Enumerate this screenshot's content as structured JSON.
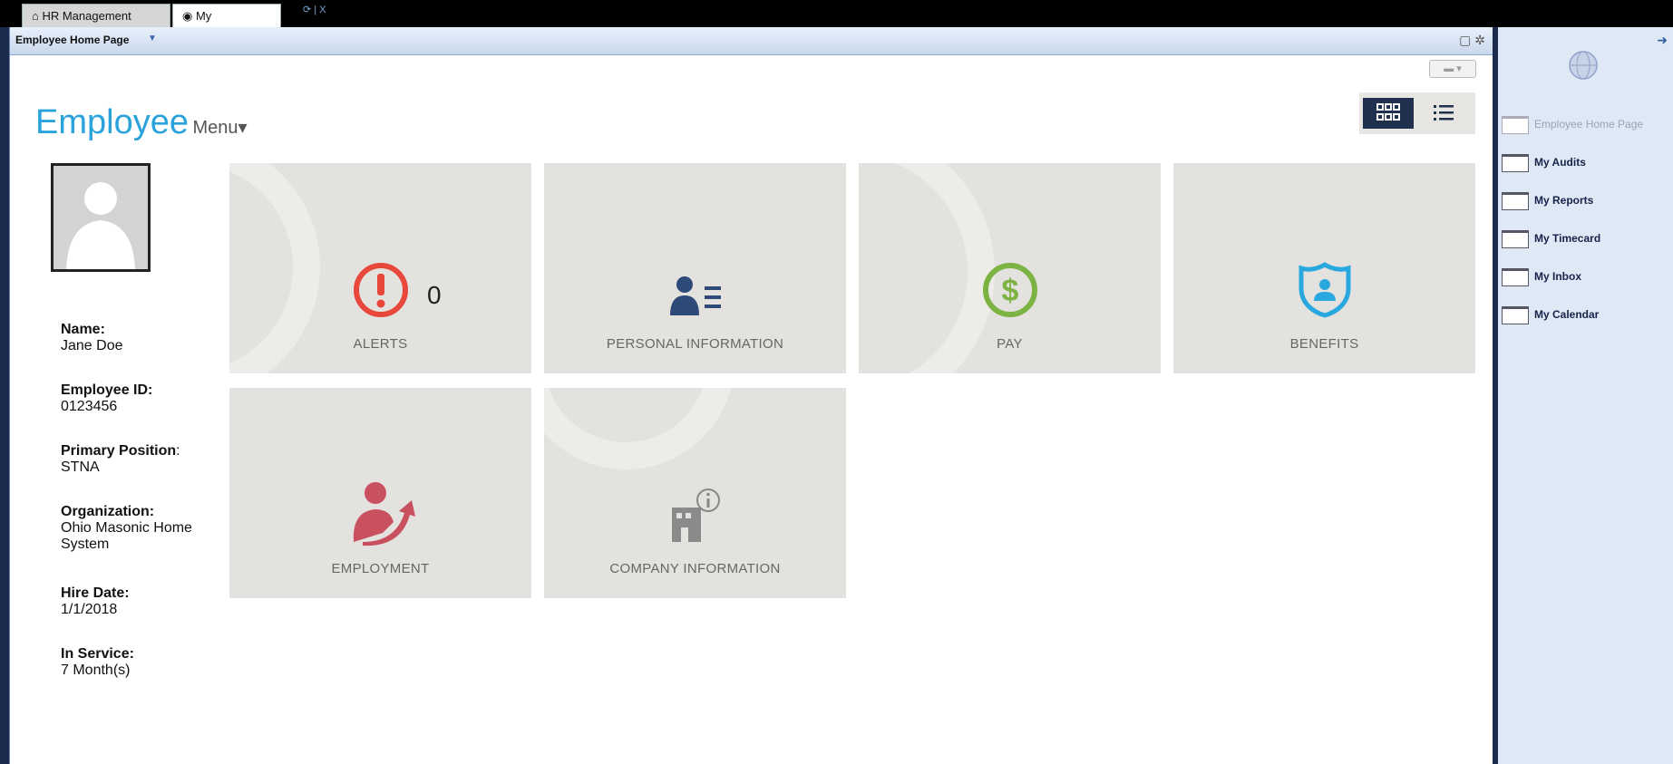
{
  "tabs": {
    "hr": "HR Management",
    "info": "My Information",
    "controls": "⟳ | X"
  },
  "frame": {
    "title": "Employee Home Page",
    "dropdown": "▼"
  },
  "header": {
    "title": "Employee",
    "menu": "Menu▾"
  },
  "profile": {
    "name_label": "Name:",
    "name": "Jane Doe",
    "id_label": "Employee ID:",
    "id": "0123456",
    "pos_label": "Primary Position",
    "pos_colon": ":",
    "pos": "STNA",
    "org_label": "Organization:",
    "org": "Ohio Masonic Home System",
    "hire_label": "Hire Date:",
    "hire": "1/1/2018",
    "svc_label": "In Service:",
    "svc": "7 Month(s)"
  },
  "tiles": {
    "alerts": "ALERTS",
    "alerts_count": "0",
    "personal": "PERSONAL INFORMATION",
    "pay": "PAY",
    "benefits": "BENEFITS",
    "employment": "EMPLOYMENT",
    "company": "COMPANY INFORMATION"
  },
  "sidebar": {
    "items": [
      "Employee Home Page",
      "My Audits",
      "My Reports",
      "My Timecard",
      "My Inbox",
      "My Calendar"
    ]
  },
  "colors": {
    "accent": "#2aa3dc",
    "alert": "#e8483b",
    "pay": "#7cb342",
    "benefits": "#29a8e0",
    "personal": "#2d4a78",
    "employment": "#c9505e"
  }
}
